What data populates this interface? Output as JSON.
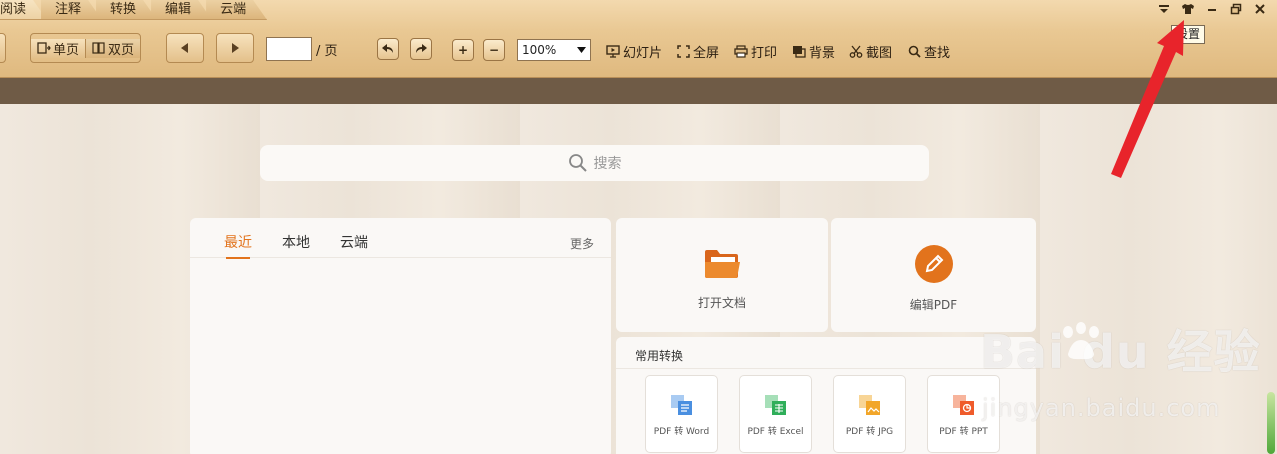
{
  "tabs": [
    {
      "label": "阅读",
      "active": true
    },
    {
      "label": "注释"
    },
    {
      "label": "转换"
    },
    {
      "label": "编辑"
    },
    {
      "label": "云端"
    }
  ],
  "window": {
    "tooltip": "设置"
  },
  "toolbar": {
    "single_page": "单页",
    "double_page": "双页",
    "page_suffix": "/ 页",
    "page_value": "",
    "zoom": "100%",
    "slideshow": "幻灯片",
    "fullscreen": "全屏",
    "print": "打印",
    "background": "背景",
    "screenshot": "截图",
    "find": "查找"
  },
  "search": {
    "placeholder": "搜索"
  },
  "recent": {
    "tabs": [
      "最近",
      "本地",
      "云端"
    ],
    "more": "更多"
  },
  "cards": {
    "open": "打开文档",
    "edit": "编辑PDF"
  },
  "conversion": {
    "title": "常用转换",
    "items": [
      {
        "label": "PDF 转 Word",
        "color": "#4a8fe0"
      },
      {
        "label": "PDF 转 Excel",
        "color": "#2fae5a"
      },
      {
        "label": "PDF 转 JPG",
        "color": "#f2a629"
      },
      {
        "label": "PDF 转 PPT",
        "color": "#ef5b2b"
      }
    ]
  },
  "watermark": {
    "main": "Bai du 经验",
    "sub": "jingyan.baidu.com"
  },
  "colors": {
    "accent": "#e2731c",
    "toolbar": "#e6c48f",
    "brownbar": "#6f5b46",
    "arrow": "#e8242b"
  }
}
